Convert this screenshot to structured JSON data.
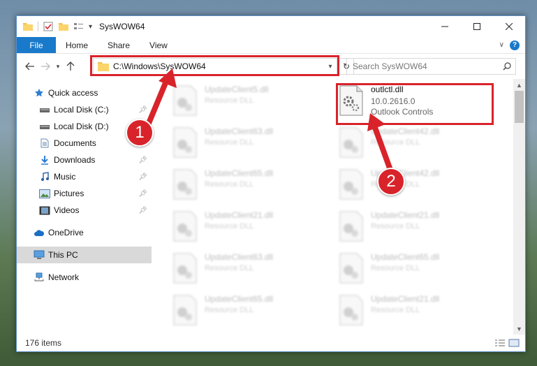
{
  "window": {
    "title": "SysWOW64"
  },
  "ribbon": {
    "file": "File",
    "tabs": [
      "Home",
      "Share",
      "View"
    ]
  },
  "address": {
    "path": "C:\\Windows\\SysWOW64"
  },
  "search": {
    "placeholder": "Search SysWOW64"
  },
  "sidebar": {
    "items": [
      {
        "label": "Quick access",
        "icon": "star-icon",
        "pinned": false
      },
      {
        "label": "Local Disk (C:)",
        "icon": "drive-icon",
        "pinned": true
      },
      {
        "label": "Local Disk (D:)",
        "icon": "drive-icon",
        "pinned": false
      },
      {
        "label": "Documents",
        "icon": "documents-icon",
        "pinned": true
      },
      {
        "label": "Downloads",
        "icon": "download-icon",
        "pinned": true
      },
      {
        "label": "Music",
        "icon": "music-icon",
        "pinned": true
      },
      {
        "label": "Pictures",
        "icon": "pictures-icon",
        "pinned": true
      },
      {
        "label": "Videos",
        "icon": "videos-icon",
        "pinned": true
      },
      {
        "label": "OneDrive",
        "icon": "cloud-icon",
        "pinned": false
      },
      {
        "label": "This PC",
        "icon": "computer-icon",
        "pinned": false
      },
      {
        "label": "Network",
        "icon": "network-icon",
        "pinned": false
      }
    ]
  },
  "files": {
    "left_column": [
      {
        "name": "UpdateClient5.dll",
        "type": "Resource DLL"
      },
      {
        "name": "UpdateClient63.dll",
        "type": "Resource DLL"
      },
      {
        "name": "UpdateClient65.dll",
        "type": "Resource DLL"
      },
      {
        "name": "UpdateClient21.dll",
        "type": "Resource DLL"
      },
      {
        "name": "UpdateClient63.dll",
        "type": "Resource DLL"
      },
      {
        "name": "UpdateClient65.dll",
        "type": "Resource DLL"
      }
    ],
    "right_column": [
      {
        "name": "outlctl.dll",
        "version": "10.0.2616.0",
        "type": "Outlook Controls"
      },
      {
        "name": "UpdateClient42.dll",
        "type": "Resource DLL"
      },
      {
        "name": "UpdateClient42.dll",
        "type": "Resource DLL"
      },
      {
        "name": "UpdateClient21.dll",
        "type": "Resource DLL"
      },
      {
        "name": "UpdateClient65.dll",
        "type": "Resource DLL"
      },
      {
        "name": "UpdateClient21.dll",
        "type": "Resource DLL"
      }
    ]
  },
  "status": {
    "count": "176 items"
  },
  "callouts": {
    "one": "1",
    "two": "2"
  },
  "colors": {
    "accent": "#1979ca",
    "highlight": "#d9232a",
    "selected": "#d9d9d9"
  }
}
